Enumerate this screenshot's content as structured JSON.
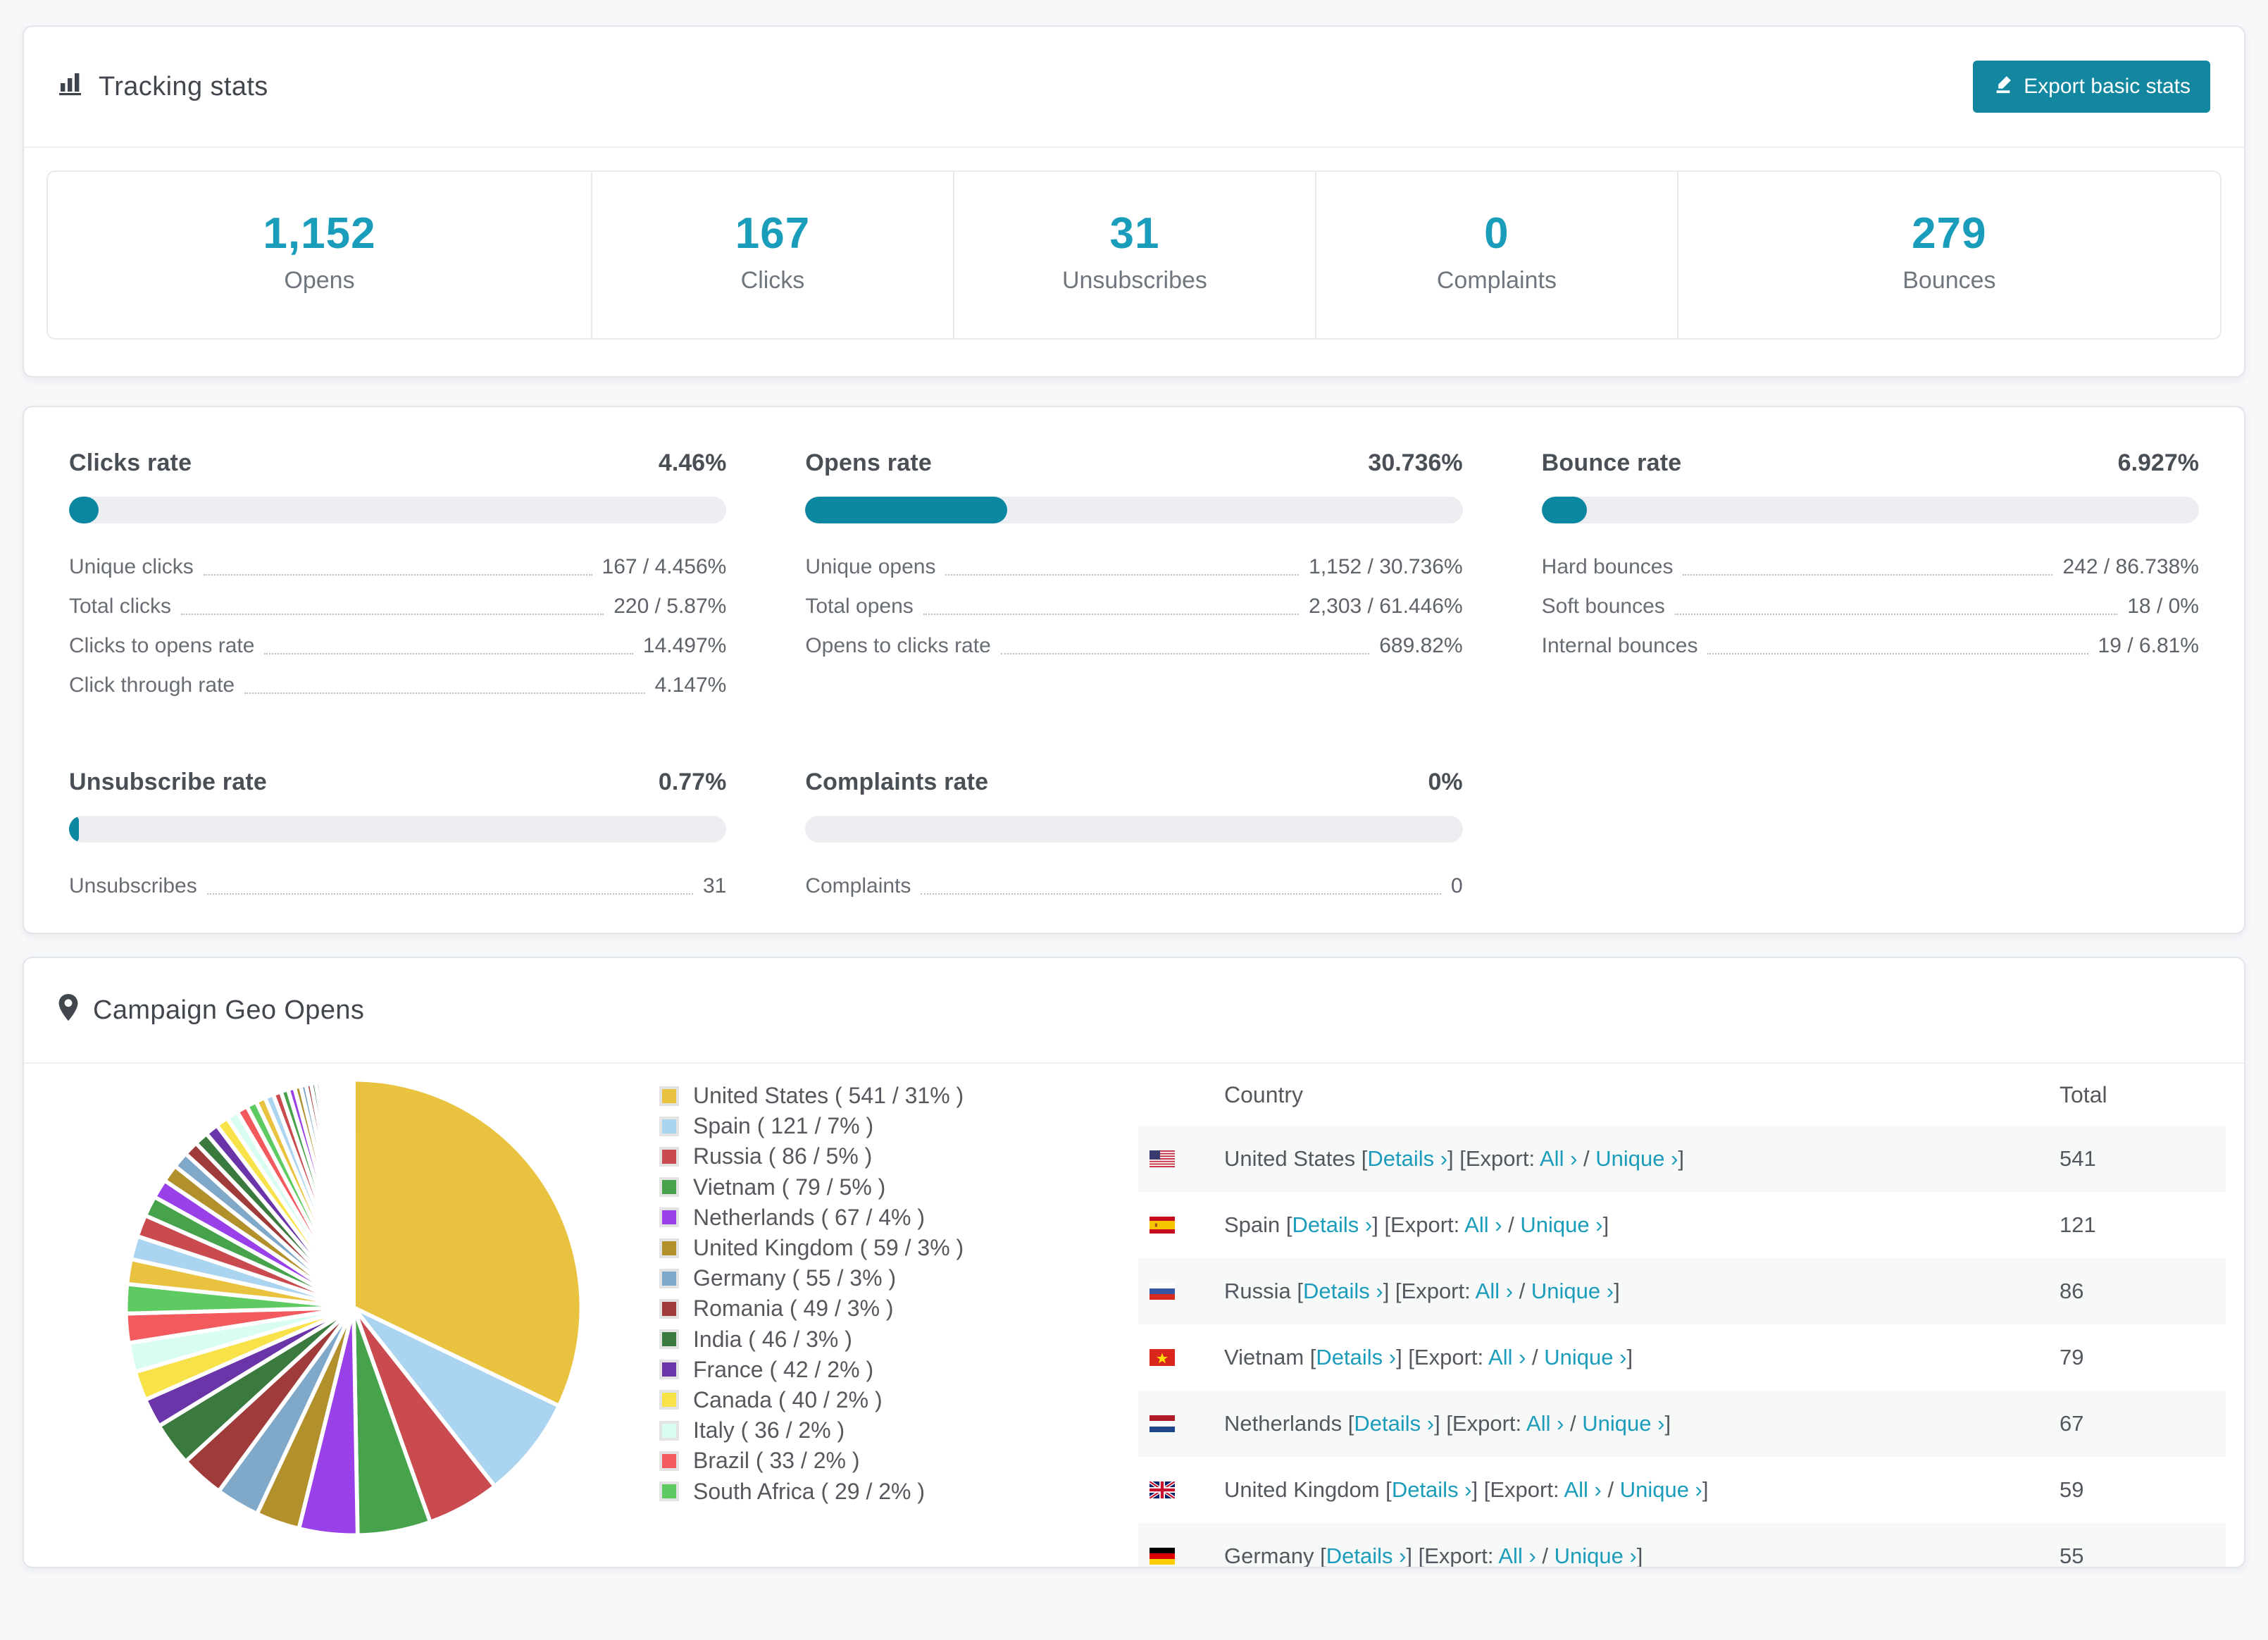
{
  "page": {
    "background": "#f7f8fa",
    "accent_teal": "#1a9dbb",
    "bar_teal": "#0b87a2"
  },
  "tracking": {
    "title": "Tracking stats",
    "export_button": "Export basic stats",
    "stats": [
      {
        "value": "1,152",
        "label": "Opens"
      },
      {
        "value": "167",
        "label": "Clicks"
      },
      {
        "value": "31",
        "label": "Unsubscribes"
      },
      {
        "value": "0",
        "label": "Complaints"
      },
      {
        "value": "279",
        "label": "Bounces"
      }
    ]
  },
  "rates": {
    "blocks": [
      {
        "title": "Clicks rate",
        "value": "4.46%",
        "percent": 4.46,
        "rows": [
          [
            "Unique clicks",
            "167 / 4.456%"
          ],
          [
            "Total clicks",
            "220 / 5.87%"
          ],
          [
            "Clicks to opens rate",
            "14.497%"
          ],
          [
            "Click through rate",
            "4.147%"
          ]
        ]
      },
      {
        "title": "Opens rate",
        "value": "30.736%",
        "percent": 30.736,
        "rows": [
          [
            "Unique opens",
            "1,152 / 30.736%"
          ],
          [
            "Total opens",
            "2,303 / 61.446%"
          ],
          [
            "Opens to clicks rate",
            "689.82%"
          ]
        ]
      },
      {
        "title": "Bounce rate",
        "value": "6.927%",
        "percent": 6.927,
        "rows": [
          [
            "Hard bounces",
            "242 / 86.738%"
          ],
          [
            "Soft bounces",
            "18 / 0%"
          ],
          [
            "Internal bounces",
            "19 / 6.81%"
          ]
        ]
      },
      {
        "title": "Unsubscribe rate",
        "value": "0.77%",
        "percent": 0.77,
        "rows": [
          [
            "Unsubscribes",
            "31"
          ]
        ]
      },
      {
        "title": "Complaints rate",
        "value": "0%",
        "percent": 0,
        "rows": [
          [
            "Complaints",
            "0"
          ]
        ]
      }
    ]
  },
  "geo": {
    "title": "Campaign Geo Opens",
    "chart_data": {
      "type": "pie",
      "slices": [
        {
          "name": "United States",
          "value": 541,
          "percent": 31
        },
        {
          "name": "Spain",
          "value": 121,
          "percent": 7
        },
        {
          "name": "Russia",
          "value": 86,
          "percent": 5
        },
        {
          "name": "Vietnam",
          "value": 79,
          "percent": 5
        },
        {
          "name": "Netherlands",
          "value": 67,
          "percent": 4
        },
        {
          "name": "United Kingdom",
          "value": 59,
          "percent": 3
        },
        {
          "name": "Germany",
          "value": 55,
          "percent": 3
        },
        {
          "name": "Romania",
          "value": 49,
          "percent": 3
        },
        {
          "name": "India",
          "value": 46,
          "percent": 3
        },
        {
          "name": "France",
          "value": 42,
          "percent": 2
        },
        {
          "name": "Canada",
          "value": 40,
          "percent": 2
        },
        {
          "name": "Italy",
          "value": 36,
          "percent": 2
        },
        {
          "name": "Brazil",
          "value": 33,
          "percent": 2
        },
        {
          "name": "South Africa",
          "value": 29,
          "percent": 2
        }
      ],
      "others_unlabeled_percents": [
        1.7,
        1.6,
        1.5,
        1.4,
        1.3,
        1.2,
        1.1,
        1.0,
        0.95,
        0.9,
        0.85,
        0.8,
        0.75,
        0.7,
        0.65,
        0.6,
        0.55,
        0.5,
        0.46,
        0.42,
        0.38,
        0.35,
        0.32,
        0.29,
        0.26,
        0.24,
        0.22,
        0.2,
        0.18,
        0.16,
        0.14,
        0.12,
        0.11,
        0.1,
        0.09,
        0.08,
        0.07,
        0.06,
        0.05,
        0.045,
        0.04,
        0.035,
        0.03,
        0.025,
        0.02
      ],
      "palette": [
        "#e9c23f",
        "#abd4f1",
        "#c94b4f",
        "#46a34c",
        "#9a40e8",
        "#b2902c",
        "#7fa8c9",
        "#a03b3b",
        "#3b7a3e",
        "#6a35a8",
        "#f8e24a",
        "#d9fdf3",
        "#f25a5e",
        "#5ecb62"
      ],
      "legend_position": "right"
    },
    "table": {
      "headers": [
        "Country",
        "Total"
      ],
      "link_labels": {
        "details": "Details ›",
        "all": "All ›",
        "unique": "Unique ›",
        "open_bracket": "[",
        "close_bracket": "]",
        "export_prefix": "[Export:",
        "slash": "/"
      },
      "rows": [
        {
          "country": "United States",
          "flag": "us",
          "total": "541"
        },
        {
          "country": "Spain",
          "flag": "es",
          "total": "121"
        },
        {
          "country": "Russia",
          "flag": "ru",
          "total": "86"
        },
        {
          "country": "Vietnam",
          "flag": "vn",
          "total": "79"
        },
        {
          "country": "Netherlands",
          "flag": "nl",
          "total": "67"
        },
        {
          "country": "United Kingdom",
          "flag": "gb",
          "total": "59"
        },
        {
          "country": "Germany",
          "flag": "de",
          "total": "55"
        }
      ]
    }
  }
}
